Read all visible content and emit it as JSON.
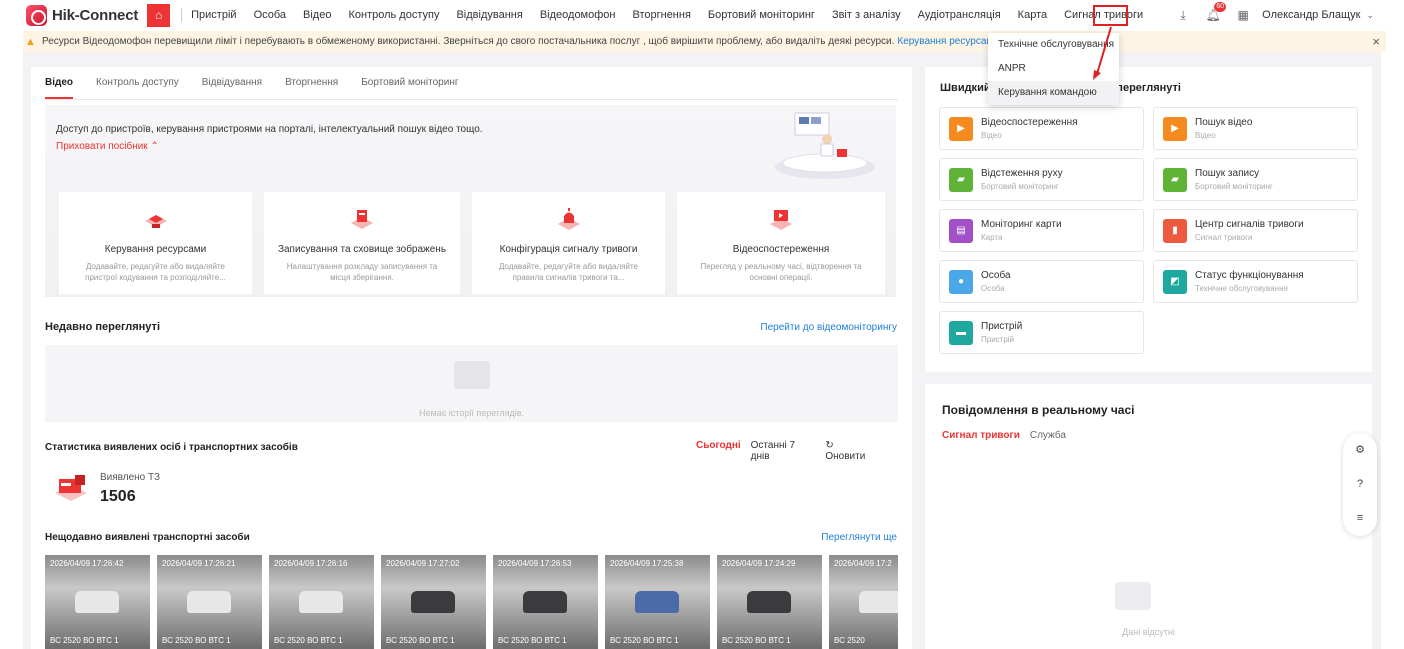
{
  "header": {
    "logo_text": "Hik-Connect",
    "nav": [
      "Пристрій",
      "Особа",
      "Відео",
      "Контроль доступу",
      "Відвідування",
      "Відеодомофон",
      "Вторгнення",
      "Бортовий моніторинг",
      "Звіт з аналізу",
      "Аудіотрансляція",
      "Карта",
      "Сигнал тривоги"
    ],
    "more_label": "···",
    "notification_count": "60",
    "user_name": "Олександр Блащук"
  },
  "notice": {
    "text": "Ресурси Відеодомофон перевищили ліміт і перебувають в обмеженому використанні. Зверніться до свого постачальника послуг , щоб вирішити проблему, або видаліть деякі ресурси.",
    "link": "Керування ресурсами"
  },
  "dropdown": {
    "items": [
      "Технічне обслуговування",
      "ANPR",
      "Керування командою"
    ]
  },
  "left": {
    "tabs": [
      "Відео",
      "Контроль доступу",
      "Відвідування",
      "Вторгнення",
      "Бортовий моніторинг"
    ],
    "guide_text": "Доступ до пристроїв, керування пристроями на порталі, інтелектуальний пошук відео тощо.",
    "guide_hide": "Приховати посібник",
    "cards": [
      {
        "title": "Керування ресурсами",
        "desc": "Додавайте, редагуйте або видаляйте пристрої кодування та розподіляйте..."
      },
      {
        "title": "Записування та сховище зображень",
        "desc": "Налаштування розкладу записування та місця зберігання."
      },
      {
        "title": "Конфігурація сигналу тривоги",
        "desc": "Додавайте, редагуйте або видаляйте правила сигналів тривоги та..."
      },
      {
        "title": "Відеоспостереження",
        "desc": "Перегляд у реальному часі, відтворення та основні операції."
      }
    ],
    "recent_title": "Недавно переглянуті",
    "recent_link": "Перейти до відеомоніторингу",
    "recent_empty": "Немає історії переглядів.",
    "stats_title": "Статистика виявлених осіб і транспортних засобів",
    "stats_filter": [
      "Сьогодні",
      "Останні 7 днів",
      "Оновити"
    ],
    "stat_label": "Виявлено ТЗ",
    "stat_value": "1506",
    "recent_vehicles_title": "Нещодавно виявлені транспортні засоби",
    "recent_vehicles_link": "Переглянути ще",
    "thumbnails": [
      {
        "time": "2026/04/09 17:26:42",
        "plate": "ВС 2520 ВО ВТС 1",
        "car": "white"
      },
      {
        "time": "2026/04/09 17:26:21",
        "plate": "ВС 2520 ВО ВТС 1",
        "car": "white"
      },
      {
        "time": "2026/04/09 17:26:16",
        "plate": "ВС 2520 ВО ВТС 1",
        "car": "white"
      },
      {
        "time": "2026/04/09 17:27:02",
        "plate": "ВС 2520 ВО ВТС 1",
        "car": "dark"
      },
      {
        "time": "2026/04/09 17:26:53",
        "plate": "ВС 2520 ВО ВТС 1",
        "car": "dark"
      },
      {
        "time": "2026/04/09 17:25:38",
        "plate": "ВС 2520 ВО ВТС 1",
        "car": "blue"
      },
      {
        "time": "2026/04/09 17:24:29",
        "plate": "ВС 2520 ВО ВТС 1",
        "car": "dark"
      },
      {
        "time": "2026/04/09 17:2",
        "plate": "ВС 2520",
        "car": "white"
      }
    ]
  },
  "quick": {
    "title": "Швидкий доступ до нещодавно переглянуті",
    "items": [
      {
        "name": "Відеоспостереження",
        "sub": "Відео",
        "color": "#f58a1f",
        "icon": "video-camera-icon"
      },
      {
        "name": "Пошук відео",
        "sub": "Відео",
        "color": "#f58a1f",
        "icon": "video-search-icon"
      },
      {
        "name": "Відстеження руху",
        "sub": "Бортовий моніторинг",
        "color": "#5fb336",
        "icon": "vehicle-icon"
      },
      {
        "name": "Пошук запису",
        "sub": "Бортовий моніторинг",
        "color": "#5fb336",
        "icon": "vehicle-search-icon"
      },
      {
        "name": "Моніторинг карти",
        "sub": "Карта",
        "color": "#a150c8",
        "icon": "map-icon"
      },
      {
        "name": "Центр сигналів тривоги",
        "sub": "Сигнал тривоги",
        "color": "#ee5a3f",
        "icon": "alarm-icon"
      },
      {
        "name": "Особа",
        "sub": "Особа",
        "color": "#4aa8e8",
        "icon": "person-icon"
      },
      {
        "name": "Статус функціонування",
        "sub": "Технічне обслуговування",
        "color": "#1fa8a0",
        "icon": "status-icon"
      },
      {
        "name": "Пристрій",
        "sub": "Пристрій",
        "color": "#1fa8a0",
        "icon": "device-icon"
      }
    ]
  },
  "realtime": {
    "title": "Повідомлення в реальному часі",
    "tabs": [
      "Сигнал тривоги",
      "Служба"
    ],
    "empty": "Дані відсутні"
  },
  "colors": {
    "accent": "#e33333",
    "link": "#1e7fd9",
    "annotation": "#e02020"
  }
}
